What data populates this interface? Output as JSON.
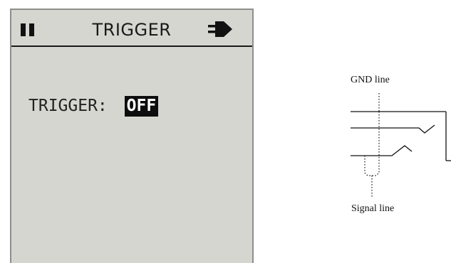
{
  "screen": {
    "title": "TRIGGER",
    "icons": {
      "left": "pause-icon",
      "right": "plug-icon"
    },
    "trigger_label": "TRIGGER: ",
    "trigger_value": "OFF"
  },
  "diagram": {
    "gnd_label": "GND line",
    "signal_label": "Signal line"
  },
  "colors": {
    "screen_bg": "#d5d6cf",
    "value_highlight": "#0d0d0d"
  }
}
